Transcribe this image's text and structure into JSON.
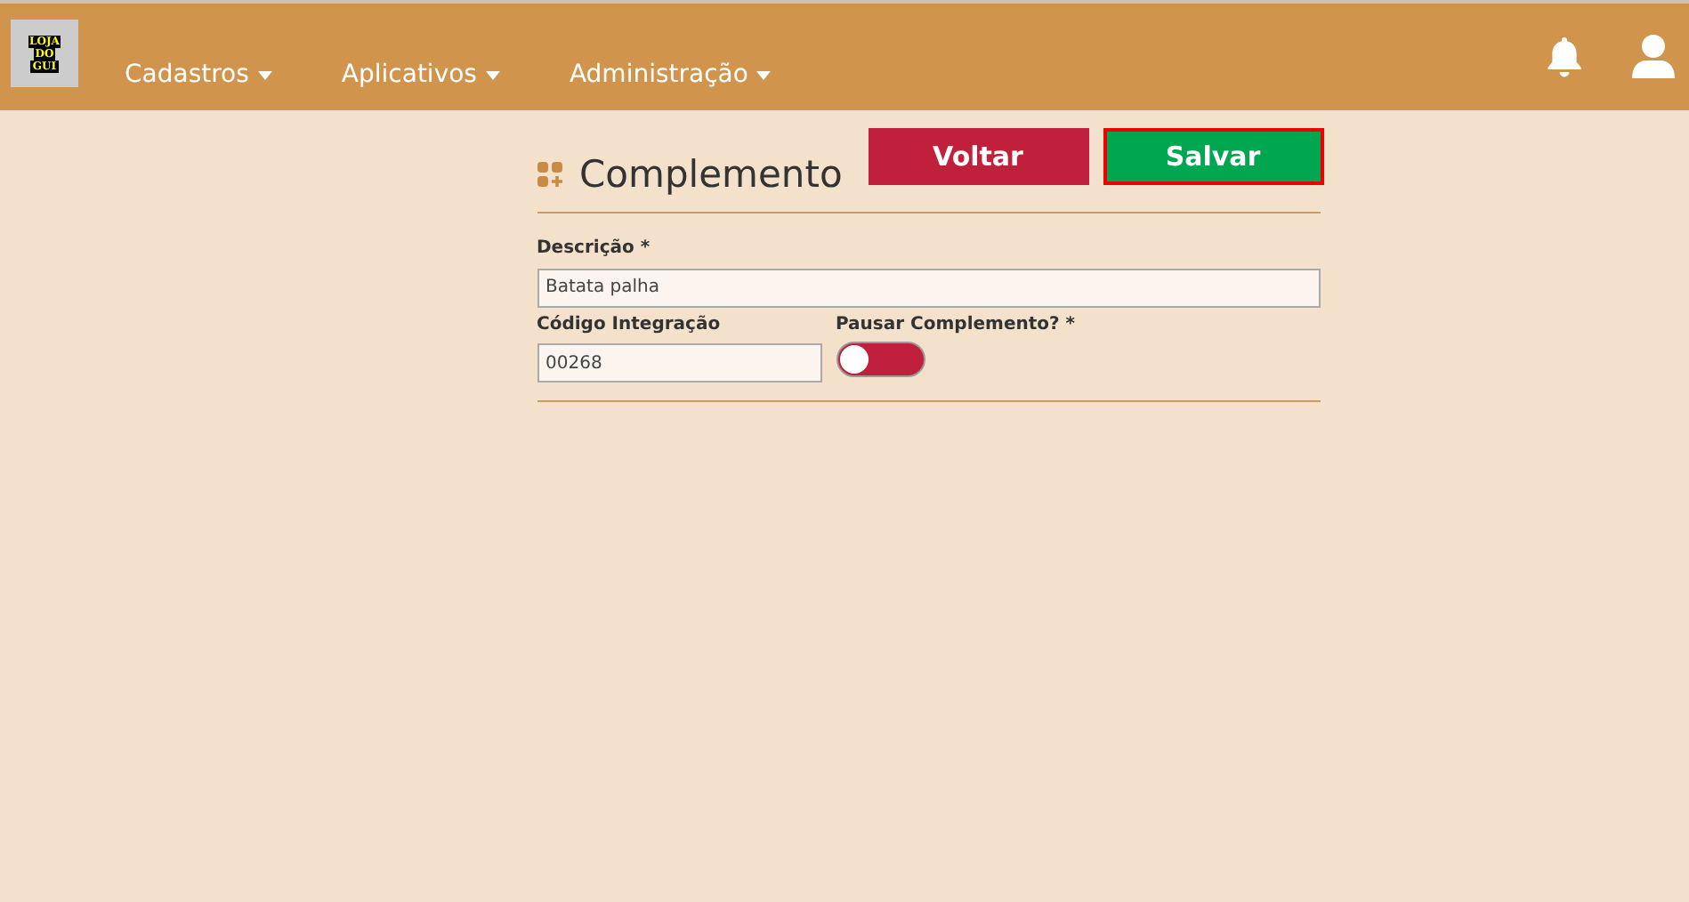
{
  "navbar": {
    "logo": [
      "LOJA",
      "DO",
      "GUI"
    ],
    "menus": [
      {
        "label": "Cadastros"
      },
      {
        "label": "Aplicativos"
      },
      {
        "label": "Administração"
      }
    ]
  },
  "form": {
    "title": "Complemento",
    "buttons": [
      {
        "label": "Voltar",
        "kind": "back",
        "focused": false
      },
      {
        "label": "Salvar",
        "kind": "save",
        "focused": true
      }
    ],
    "fields": [
      {
        "label": "Descrição *",
        "value": "Batata palha",
        "kind": "text"
      },
      {
        "label": "Código Integração",
        "value": "00268",
        "kind": "text"
      },
      {
        "label": "Pausar Complemento? *",
        "kind": "toggle",
        "on": false
      }
    ]
  }
}
